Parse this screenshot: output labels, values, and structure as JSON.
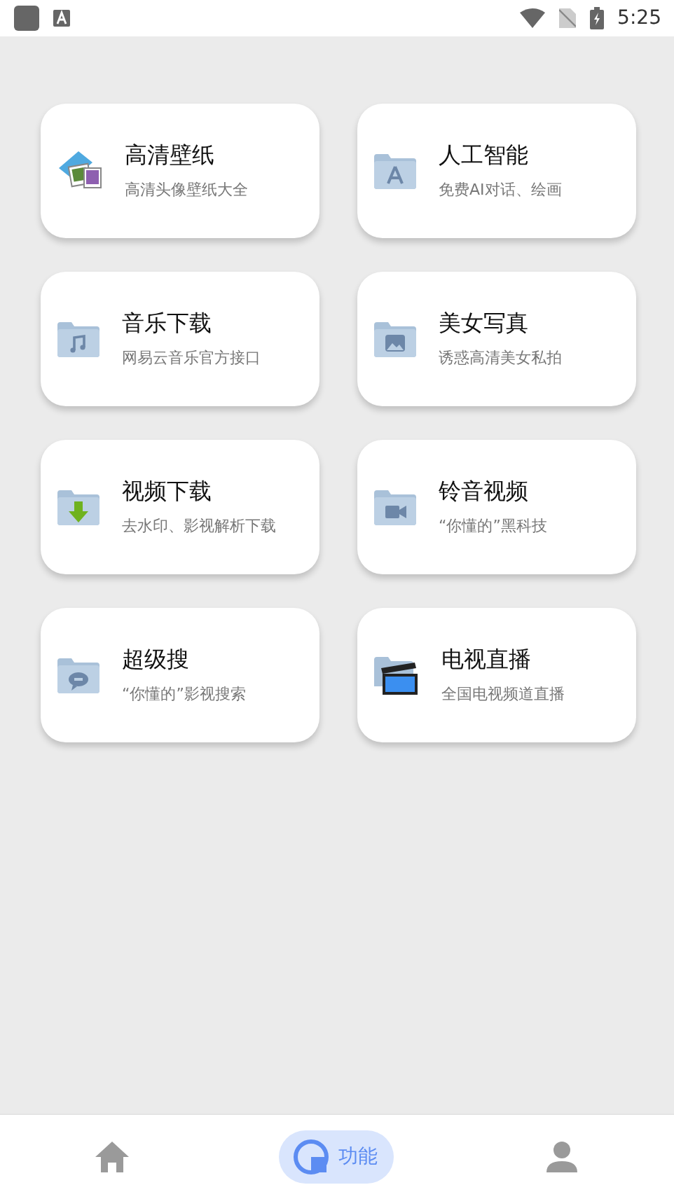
{
  "status_bar": {
    "time": "5:25"
  },
  "features": [
    {
      "title": "高清壁纸",
      "subtitle": "高清头像壁纸大全",
      "kind": "pictures"
    },
    {
      "title": "人工智能",
      "subtitle": "免费AI对话、绘画",
      "kind": "compass"
    },
    {
      "title": "音乐下载",
      "subtitle": "网易云音乐官方接口",
      "kind": "music"
    },
    {
      "title": "美女写真",
      "subtitle": "诱惑高清美女私拍",
      "kind": "image"
    },
    {
      "title": "视频下载",
      "subtitle": "去水印、影视解析下载",
      "kind": "download"
    },
    {
      "title": "铃音视频",
      "subtitle": "“你懂的”黑科技",
      "kind": "video"
    },
    {
      "title": "超级搜",
      "subtitle": "“你懂的”影视搜索",
      "kind": "chat"
    },
    {
      "title": "电视直播",
      "subtitle": "全国电视频道直播",
      "kind": "clapper"
    }
  ],
  "bottom_nav": [
    {
      "kind": "home",
      "selected": false
    },
    {
      "kind": "features",
      "selected": true,
      "label": "功能"
    },
    {
      "kind": "profile",
      "selected": false
    }
  ]
}
